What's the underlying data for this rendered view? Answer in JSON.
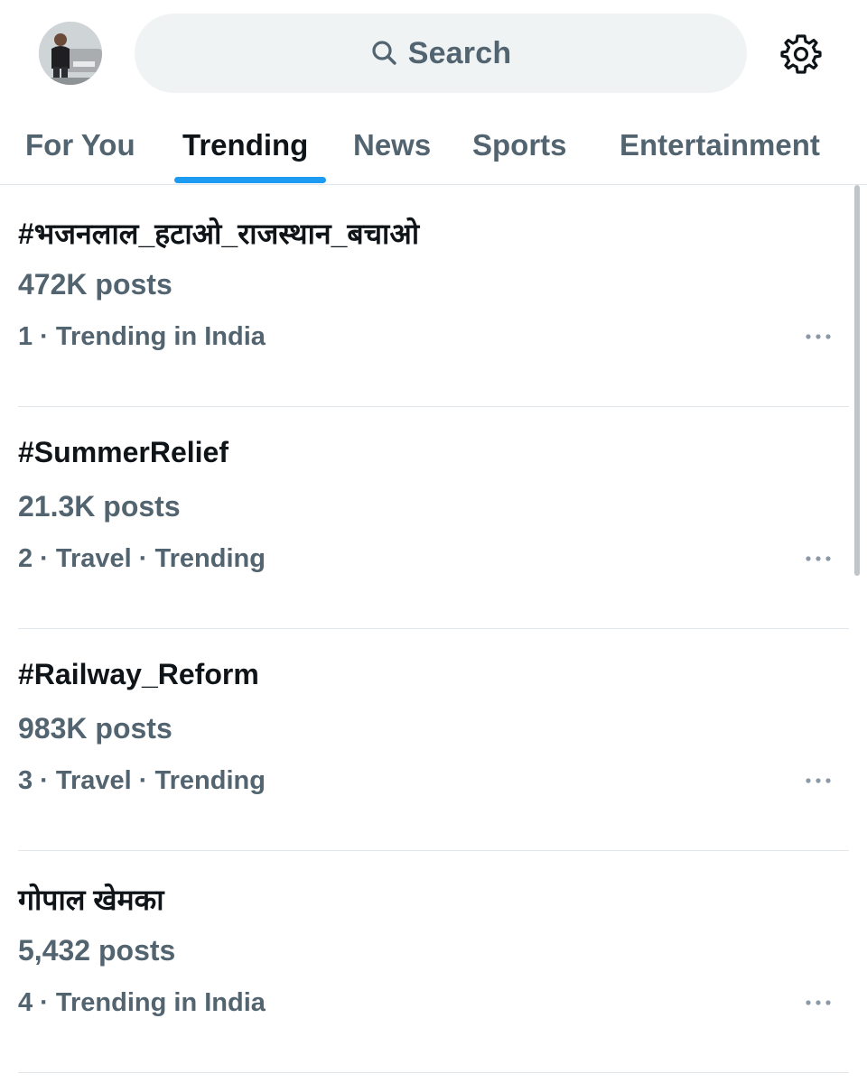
{
  "header": {
    "search_label": "Search",
    "avatar_icon": "user-avatar",
    "settings_icon": "gear-icon"
  },
  "tabs": [
    {
      "label": "For You",
      "active": false
    },
    {
      "label": "Trending",
      "active": true
    },
    {
      "label": "News",
      "active": false
    },
    {
      "label": "Sports",
      "active": false
    },
    {
      "label": "Entertainment",
      "active": false
    }
  ],
  "trends": [
    {
      "name": "#भजनलाल_हटाओ_राजस्थान_बचाओ",
      "count": "472K posts",
      "meta": "1 · Trending in India"
    },
    {
      "name": "#SummerRelief",
      "count": "21.3K posts",
      "meta": "2 · Travel · Trending"
    },
    {
      "name": "#Railway_Reform",
      "count": "983K posts",
      "meta": "3 · Travel · Trending"
    },
    {
      "name": "गोपाल खेमका",
      "count": "5,432 posts",
      "meta": "4 · Trending in India"
    }
  ],
  "colors": {
    "accent": "#1d9bf0",
    "primary_text": "#0f1419",
    "secondary_text": "#536471",
    "search_bg": "#eff3f4",
    "divider": "#e1e6ea"
  }
}
